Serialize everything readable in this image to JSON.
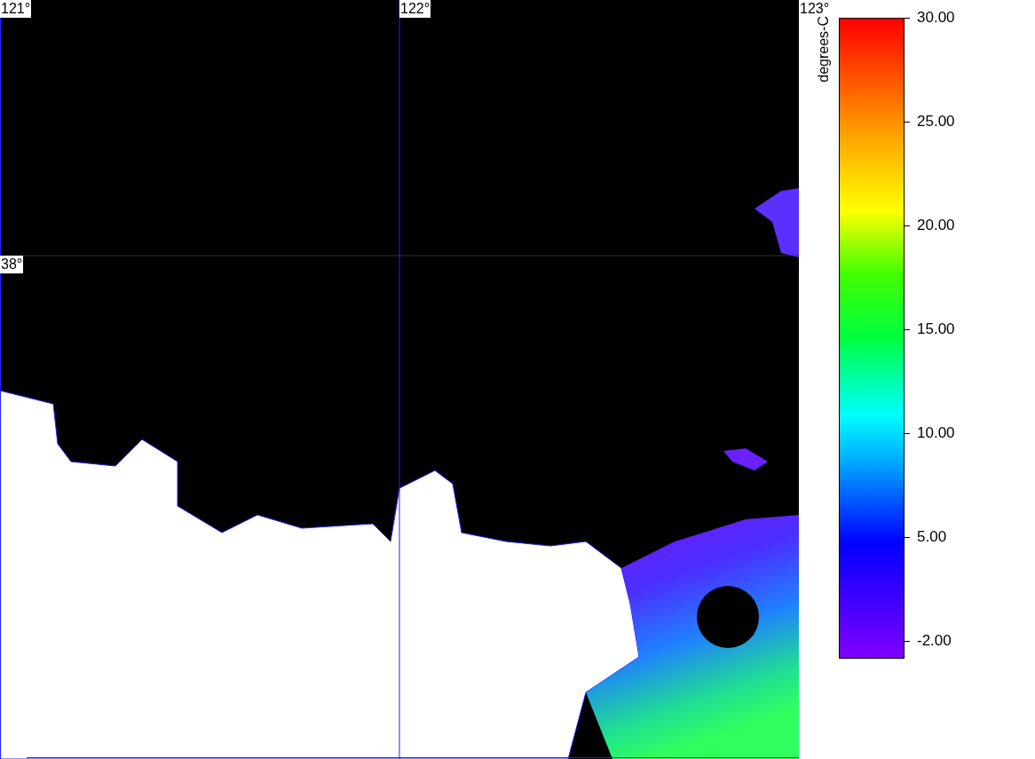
{
  "map": {
    "longitude_labels": [
      "121°",
      "122°",
      "123°"
    ],
    "latitude_labels": [
      "38°"
    ]
  },
  "colorbar": {
    "unit": "degrees-C",
    "ticks": [
      "30.00",
      "25.00",
      "20.00",
      "15.00",
      "10.00",
      "5.00",
      "-2.00"
    ]
  }
}
